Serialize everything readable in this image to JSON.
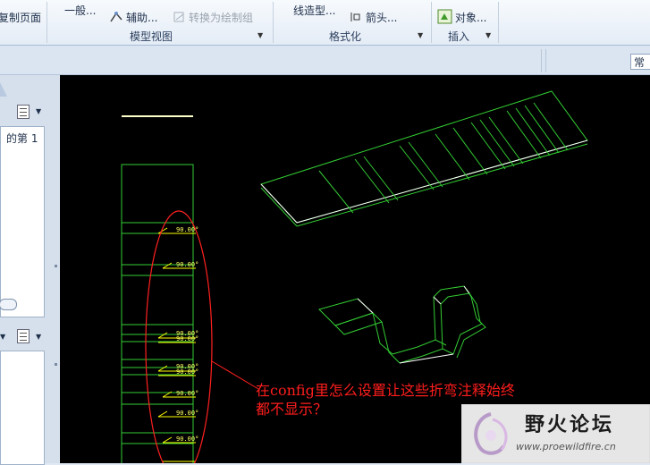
{
  "ribbon": {
    "row1": {
      "print_page": "复制页面",
      "general": "一般...",
      "auxiliary": "辅助...",
      "convert_to_draft_group": "转换为绘制组",
      "line_style": "线造型...",
      "arrow": "箭头...",
      "object": "对象..."
    },
    "groups": {
      "model_view": "模型视图",
      "format": "格式化",
      "insert": "插入"
    }
  },
  "mode_button": "常规",
  "left_panel": {
    "page_label": "的第 1"
  },
  "drawing": {
    "dim_labels": [
      "90.00°",
      "90.00°",
      "90.00°",
      "90.00°",
      "90.00°",
      "90.00°",
      "90.00°",
      "90.00°",
      "90.00°"
    ]
  },
  "annotation": {
    "line1": "在config里怎么设置让这些折弯注释始终",
    "line2": "都不显示？"
  },
  "watermark": {
    "title": "野火论坛",
    "url": "www.proewildfire.cn"
  },
  "colors": {
    "canvas": "#000000",
    "model_lines": "#33cc33",
    "edges": "#ffffff",
    "dimensions": "#ffff00",
    "annotation": "#ff1d1d"
  }
}
